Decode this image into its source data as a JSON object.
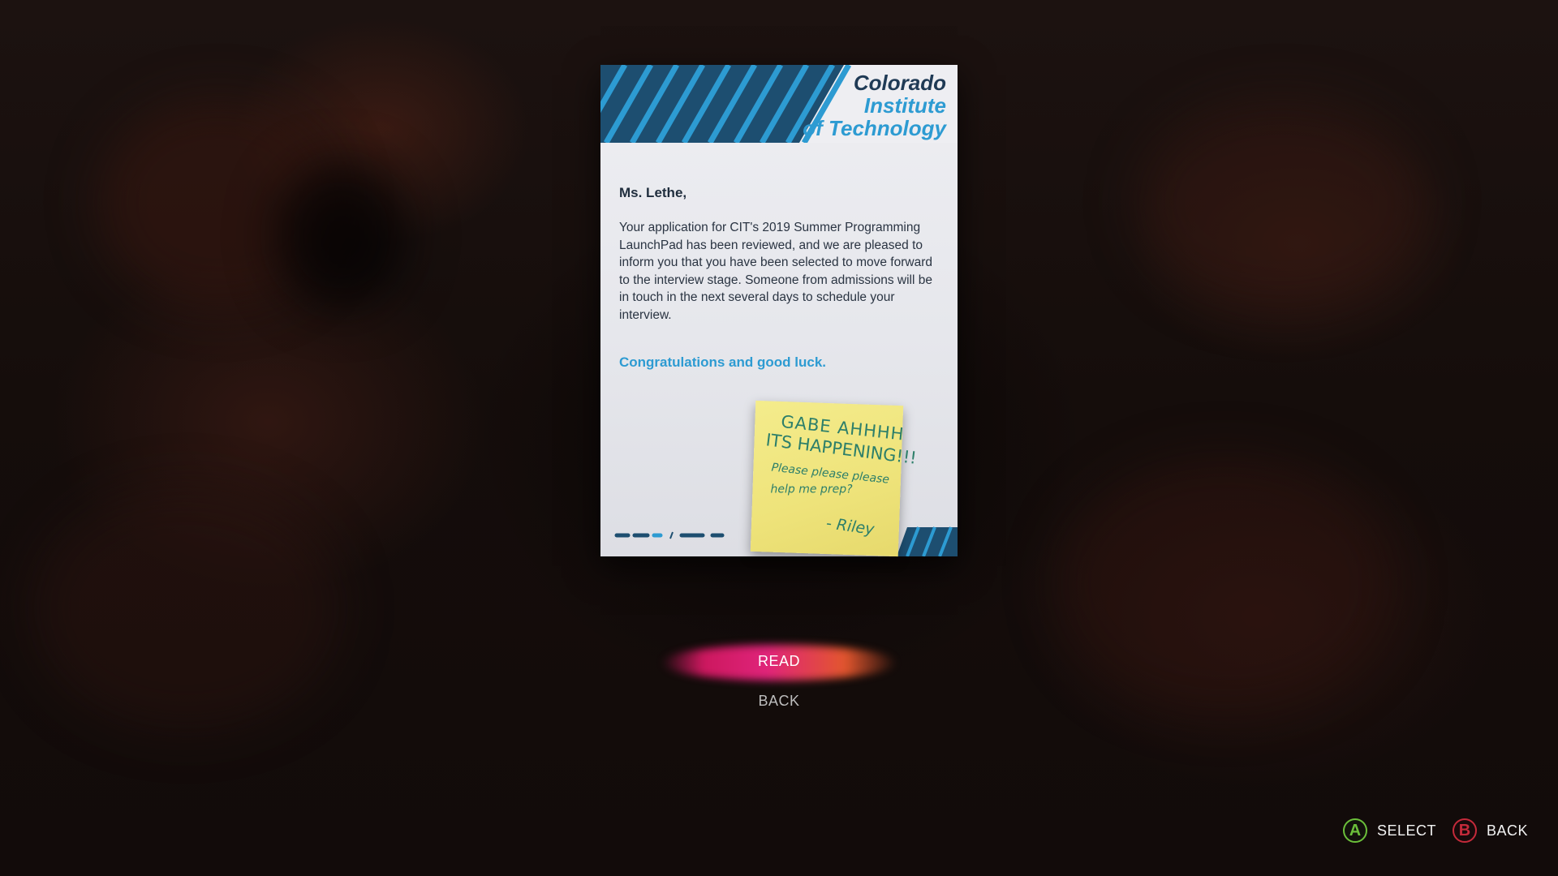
{
  "letter": {
    "brand": {
      "line1": "Colorado",
      "line2": "Institute",
      "line3": "of Technology"
    },
    "salutation": "Ms. Lethe,",
    "body": "Your application for CIT's 2019 Summer Programming LaunchPad has been reviewed, and we are pleased to inform you that you have been selected to move forward to the interview stage. Someone from admissions will be in touch in the next several days to schedule your interview.",
    "closing": "Congratulations and good luck."
  },
  "sticky_note": {
    "line1": "GABE AHHHH",
    "line2": "ITS HAPPENING!!!",
    "line3": "Please please please",
    "line4": "help me prep?",
    "signature": "- Riley"
  },
  "menu": {
    "items": [
      {
        "label": "READ",
        "selected": true
      },
      {
        "label": "BACK",
        "selected": false
      }
    ]
  },
  "prompts": {
    "select": {
      "button": "A",
      "label": "SELECT"
    },
    "back": {
      "button": "B",
      "label": "BACK"
    }
  },
  "colors": {
    "brand_dark": "#1f3a55",
    "brand_blue": "#2d9bd2",
    "stripe_dark": "#1d4e70",
    "sticky_ink": "#2d7f6a",
    "highlight_pink": "#e0247a",
    "highlight_orange": "#e2562e",
    "button_a": "#6bbf3a",
    "button_b": "#c42a3a"
  }
}
